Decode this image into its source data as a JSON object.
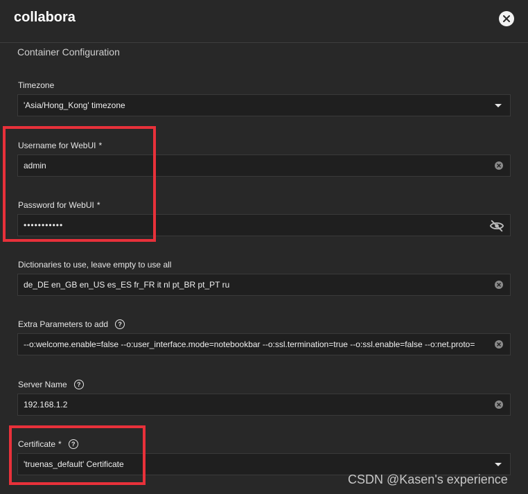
{
  "app": {
    "title": "collabora"
  },
  "section": {
    "title": "Container Configuration"
  },
  "fields": {
    "timezone": {
      "label": "Timezone",
      "value": "'Asia/Hong_Kong' timezone"
    },
    "username": {
      "label": "Username for WebUI",
      "required": "*",
      "value": "admin"
    },
    "password": {
      "label": "Password for WebUI",
      "required": "*",
      "value": "•••••••••••"
    },
    "dictionaries": {
      "label": "Dictionaries to use, leave empty to use all",
      "value": "de_DE en_GB en_US es_ES fr_FR it nl pt_BR pt_PT ru"
    },
    "extra_params": {
      "label": "Extra Parameters to add",
      "value": "--o:welcome.enable=false --o:user_interface.mode=notebookbar --o:ssl.termination=true --o:ssl.enable=false --o:net.proto="
    },
    "server_name": {
      "label": "Server Name",
      "value": "192.168.1.2"
    },
    "certificate": {
      "label": "Certificate",
      "required": "*",
      "value": "'truenas_default' Certificate"
    }
  },
  "icons": {
    "close": "close-icon",
    "dropdown": "chevron-down-icon",
    "clear": "clear-icon",
    "visibility": "eye-off-icon",
    "help": "help-icon"
  },
  "colors": {
    "background": "#282828",
    "input_bg": "#1f1f1f",
    "highlight": "#e8313a"
  },
  "watermark": {
    "text": "CSDN @Kasen's experience"
  }
}
